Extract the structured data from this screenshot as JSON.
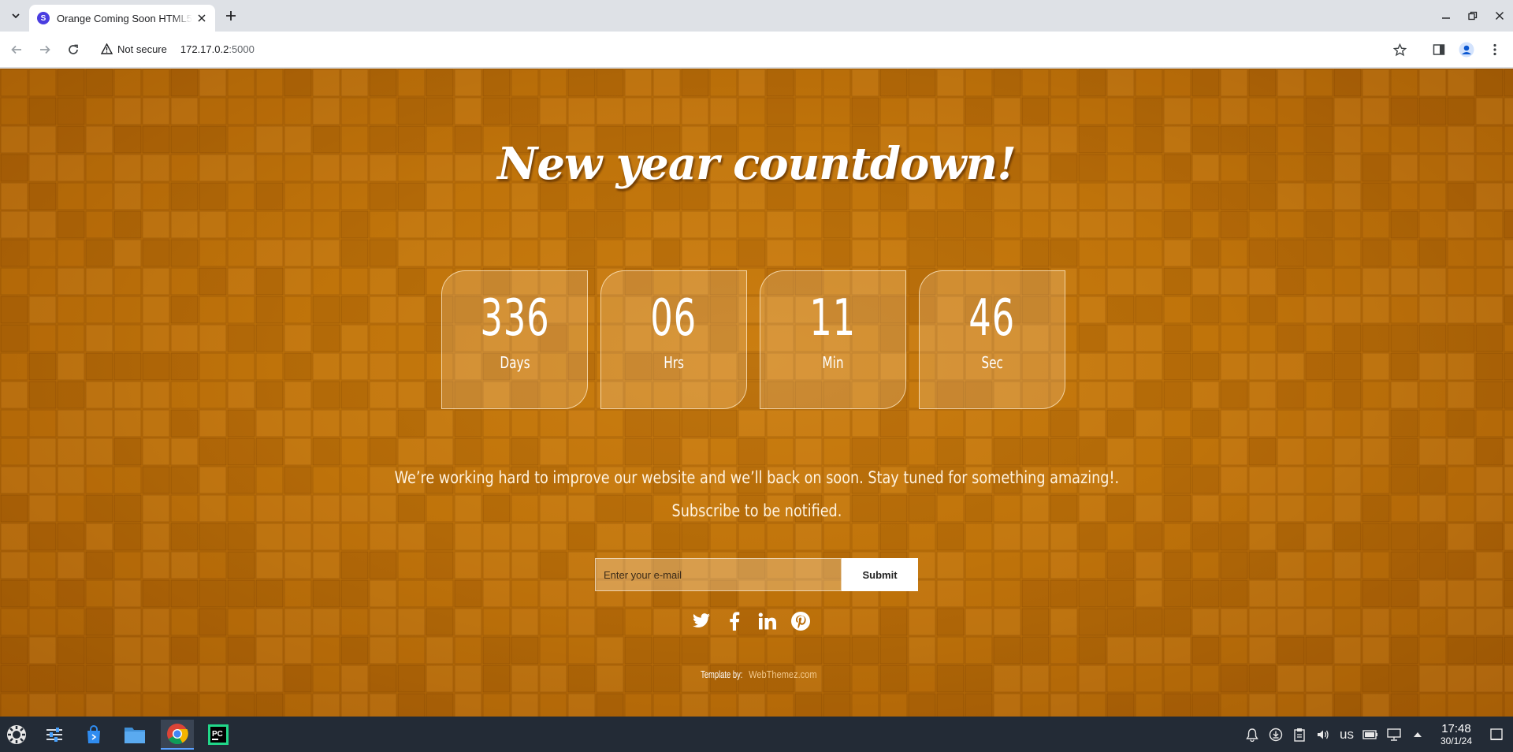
{
  "browser": {
    "tab_title": "Orange Coming Soon HTML5 Template",
    "tab_favicon_letter": "S",
    "not_secure_label": "Not secure",
    "url_host": "172.17.0.2",
    "url_port": ":5000"
  },
  "page": {
    "headline": "New year countdown!",
    "countdown": [
      {
        "value": "336",
        "label": "Days"
      },
      {
        "value": "06",
        "label": "Hrs"
      },
      {
        "value": "11",
        "label": "Min"
      },
      {
        "value": "46",
        "label": "Sec"
      }
    ],
    "message_line1": "We’re working hard to improve our website and we’ll back on soon. Stay tuned for something amazing!.",
    "message_line2": "Subscribe to be notified.",
    "email_placeholder": "Enter your e-mail",
    "submit_label": "Submit",
    "social": [
      "twitter-icon",
      "facebook-icon",
      "linkedin-icon",
      "pinterest-icon"
    ],
    "credit_prefix": "Template by:",
    "credit_link": "WebThemez.com",
    "colors": {
      "background": "#bd7109",
      "text": "#ffffff",
      "link": "#f3c98c"
    }
  },
  "taskbar": {
    "apps": [
      "system-menu-icon",
      "settings-panel-icon",
      "store-icon",
      "file-manager-icon",
      "chrome-icon",
      "pycharm-icon"
    ],
    "keyboard_layout": "us",
    "time": "17:48",
    "date": "30/1/24"
  }
}
